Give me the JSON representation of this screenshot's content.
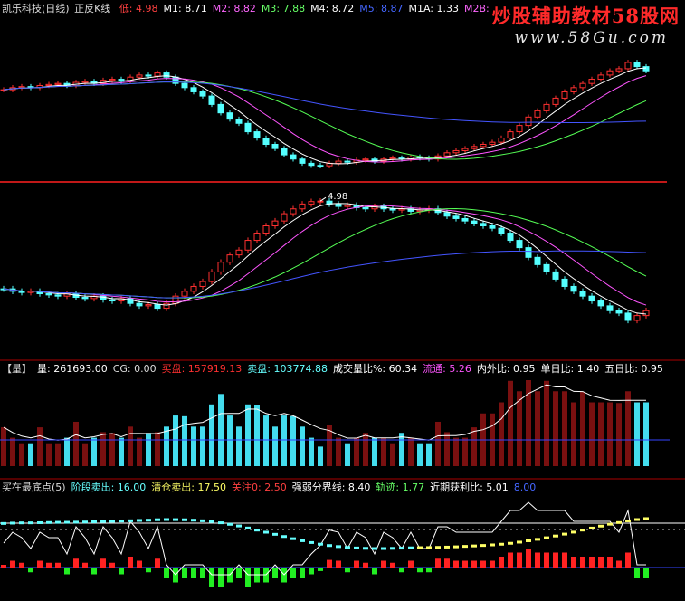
{
  "header": {
    "title": "凯乐科技(日线)",
    "indicator": "正反K线",
    "items": [
      {
        "label": "低: 4.98",
        "color": "#ff4040"
      },
      {
        "label": "M1: 8.71",
        "color": "#ffffff"
      },
      {
        "label": "M2: 8.82",
        "color": "#ff66ff"
      },
      {
        "label": "M3: 7.88",
        "color": "#66ff66"
      },
      {
        "label": "M4: 8.72",
        "color": "#ffffff"
      },
      {
        "label": "M5: 8.87",
        "color": "#4466ff"
      },
      {
        "label": "M1A: 1.33",
        "color": "#ffffff"
      },
      {
        "label": "M2B:",
        "color": "#ff66ff"
      }
    ]
  },
  "watermark": {
    "line1": "炒股辅助教材58股网",
    "line2": "www.58Gu.com"
  },
  "vol_header": {
    "items": [
      {
        "label": "【量】",
        "color": "#dddddd"
      },
      {
        "label": "量: 261693.00",
        "color": "#ffffff"
      },
      {
        "label": "CG: 0.00",
        "color": "#dddddd"
      },
      {
        "label": "买盘: 157919.13",
        "color": "#ff3030"
      },
      {
        "label": "卖盘: 103774.88",
        "color": "#66ffff"
      },
      {
        "label": "成交量比%: 60.34",
        "color": "#ffffff"
      },
      {
        "label": "流通: 5.26",
        "color": "#ff55ff"
      },
      {
        "label": "内外比: 0.95",
        "color": "#ffffff"
      },
      {
        "label": "单日比: 1.40",
        "color": "#ffffff"
      },
      {
        "label": "五日比: 0.95",
        "color": "#ffffff"
      }
    ]
  },
  "ind_header": {
    "items": [
      {
        "label": "买在最底点(5)",
        "color": "#dddddd"
      },
      {
        "label": "阶段卖出: 16.00",
        "color": "#66ffff"
      },
      {
        "label": "清仓卖出: 17.50",
        "color": "#ffff66"
      },
      {
        "label": "关注0: 2.50",
        "color": "#ff4040"
      },
      {
        "label": "强弱分界线: 8.40",
        "color": "#ffffff"
      },
      {
        "label": "轨迹: 1.77",
        "color": "#66ff66"
      },
      {
        "label": "近期获利比: 5.01",
        "color": "#ffffff"
      },
      {
        "label": "8.00",
        "color": "#4466ff"
      }
    ]
  },
  "low_marker_label": "4.98",
  "chart_data": {
    "type": "candlestick",
    "title": "凯乐科技(日线) 正反K线",
    "panels": [
      "正反K线",
      "量",
      "买在最底点(5)"
    ],
    "n_bars": 72,
    "closes": [
      8.6,
      8.7,
      8.75,
      8.7,
      8.8,
      8.85,
      8.9,
      8.8,
      8.95,
      9.0,
      8.9,
      9.05,
      9.1,
      9.0,
      9.2,
      9.3,
      9.25,
      9.4,
      9.2,
      8.9,
      8.7,
      8.5,
      8.3,
      7.9,
      7.5,
      7.2,
      7.0,
      6.6,
      6.3,
      6.0,
      5.8,
      5.5,
      5.3,
      5.1,
      5.0,
      4.98,
      5.1,
      5.2,
      5.15,
      5.25,
      5.3,
      5.2,
      5.3,
      5.35,
      5.3,
      5.4,
      5.35,
      5.3,
      5.45,
      5.6,
      5.7,
      5.8,
      5.9,
      6.0,
      6.1,
      6.3,
      6.6,
      6.9,
      7.3,
      7.6,
      7.9,
      8.2,
      8.5,
      8.7,
      8.9,
      9.1,
      9.3,
      9.5,
      9.6,
      9.9,
      9.7,
      9.5
    ],
    "low_marker": 4.98,
    "volume_scale": "relative"
  }
}
